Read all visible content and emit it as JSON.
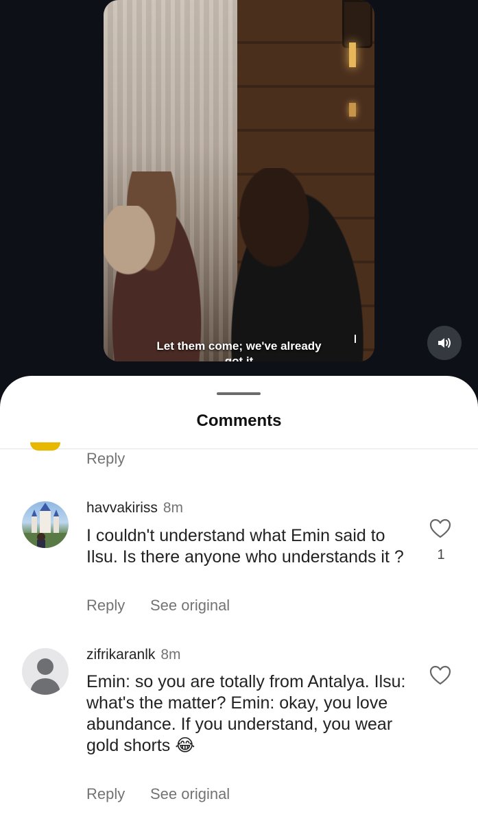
{
  "video": {
    "subtitle_line1": "Let them come; we've already",
    "subtitle_line2": "got it",
    "volume_icon": "speaker-icon"
  },
  "sheet": {
    "title": "Comments"
  },
  "comments": [
    {
      "reply_label": "Reply"
    },
    {
      "username": "havvakiriss",
      "time": "8m",
      "text": "I couldn't understand what Emin said to Ilsu. Is there anyone who understands it ?",
      "likes": "1",
      "reply_label": "Reply",
      "see_original_label": "See original"
    },
    {
      "username": "zifrikaranlk",
      "time": "8m",
      "text": "Emin: so you are totally from Antalya. Ilsu: what's the matter? Emin: okay, you love abundance. If you understand, you wear gold shorts 😂",
      "reply_label": "Reply",
      "see_original_label": "See original"
    }
  ]
}
